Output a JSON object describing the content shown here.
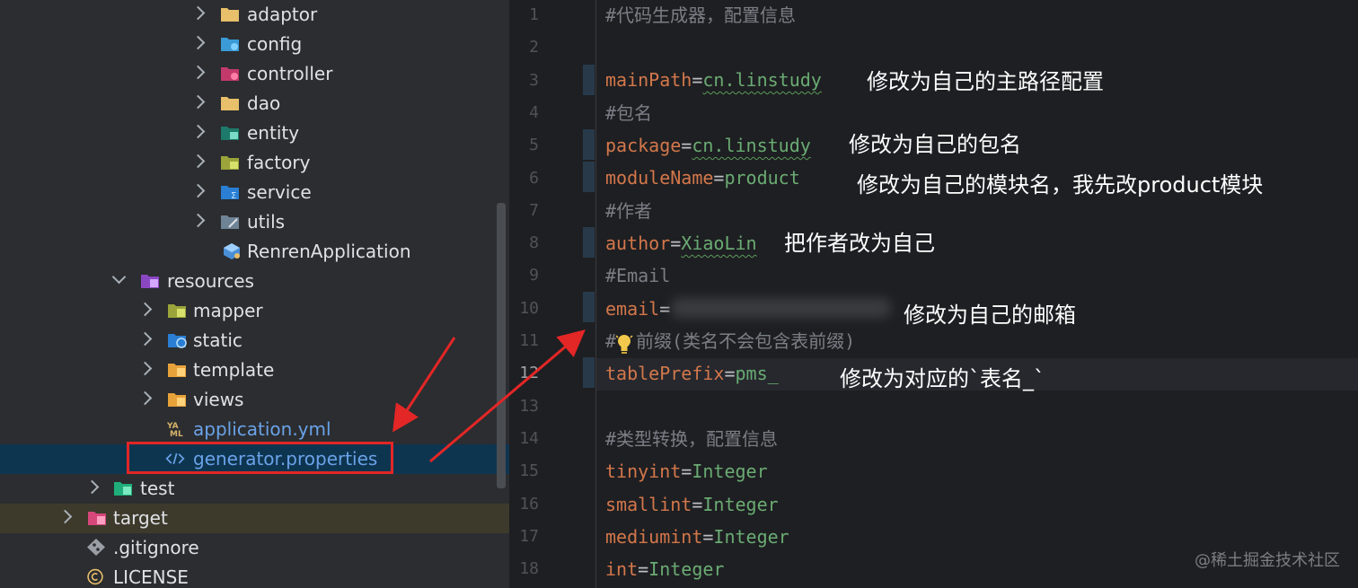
{
  "tree": {
    "items": [
      {
        "label": "adaptor"
      },
      {
        "label": "config"
      },
      {
        "label": "controller"
      },
      {
        "label": "dao"
      },
      {
        "label": "entity"
      },
      {
        "label": "factory"
      },
      {
        "label": "service"
      },
      {
        "label": "utils"
      },
      {
        "label": "RenrenApplication"
      },
      {
        "label": "resources"
      },
      {
        "label": "mapper"
      },
      {
        "label": "static"
      },
      {
        "label": "template"
      },
      {
        "label": "views"
      },
      {
        "label": "application.yml"
      },
      {
        "label": "generator.properties"
      },
      {
        "label": "test"
      },
      {
        "label": "target"
      },
      {
        "label": ".gitignore"
      },
      {
        "label": "LICENSE"
      }
    ],
    "icons": [
      "folder-icon",
      "config-folder-icon",
      "controller-folder-icon",
      "folder-icon",
      "entity-folder-icon",
      "factory-folder-icon",
      "service-folder-icon",
      "utils-folder-icon",
      "spring-app-icon",
      "resources-folder-icon",
      "mapper-folder-icon",
      "static-folder-icon",
      "template-folder-icon",
      "views-folder-icon",
      "yaml-file-icon",
      "properties-file-icon",
      "test-folder-icon",
      "target-folder-icon",
      "git-file-icon",
      "license-file-icon"
    ]
  },
  "editor": {
    "line_numbers": [
      "1",
      "2",
      "3",
      "4",
      "5",
      "6",
      "7",
      "8",
      "9",
      "10",
      "11",
      "12",
      "13",
      "14",
      "15",
      "16",
      "17",
      "18"
    ],
    "lines": {
      "l1": "#代码生成器，配置信息",
      "l3_key": "mainPath",
      "l3_val": "cn.linstudy",
      "l4": "#包名",
      "l5_key": "package",
      "l5_val": "cn.linstudy",
      "l6_key": "moduleName",
      "l6_val": "product",
      "l7": "#作者",
      "l8_key": "author",
      "l8_val": "XiaoLin",
      "l9": "#Email",
      "l10_key": "email",
      "l11_a": "#",
      "l11_b": "前缀(类名不会包含表前缀)",
      "l12_key": "tablePrefix",
      "l12_val": "pms_",
      "l14": "#类型转换，配置信息",
      "l15_key": "tinyint",
      "l15_val": "Integer",
      "l16_key": "smallint",
      "l16_val": "Integer",
      "l17_key": "mediumint",
      "l17_val": "Integer",
      "l18_key": "int",
      "l18_val": "Integer",
      "eq": "="
    },
    "notes": {
      "n3": "修改为自己的主路径配置",
      "n5": "修改为自己的包名",
      "n6": "修改为自己的模块名，我先改product模块",
      "n8": "把作者改为自己",
      "n10": "修改为自己的邮箱",
      "n12": "修改为对应的`表名_`"
    },
    "watermark": "@稀土掘金技术社区"
  },
  "colors": {
    "tree_bg": "#2b2d30",
    "editor_bg": "#1e1f22",
    "selection": "#0e3550",
    "annotation_red": "#e32626",
    "key_orange": "#d3774b",
    "value_green": "#6aab73",
    "comment_gray": "#7a7e85"
  }
}
